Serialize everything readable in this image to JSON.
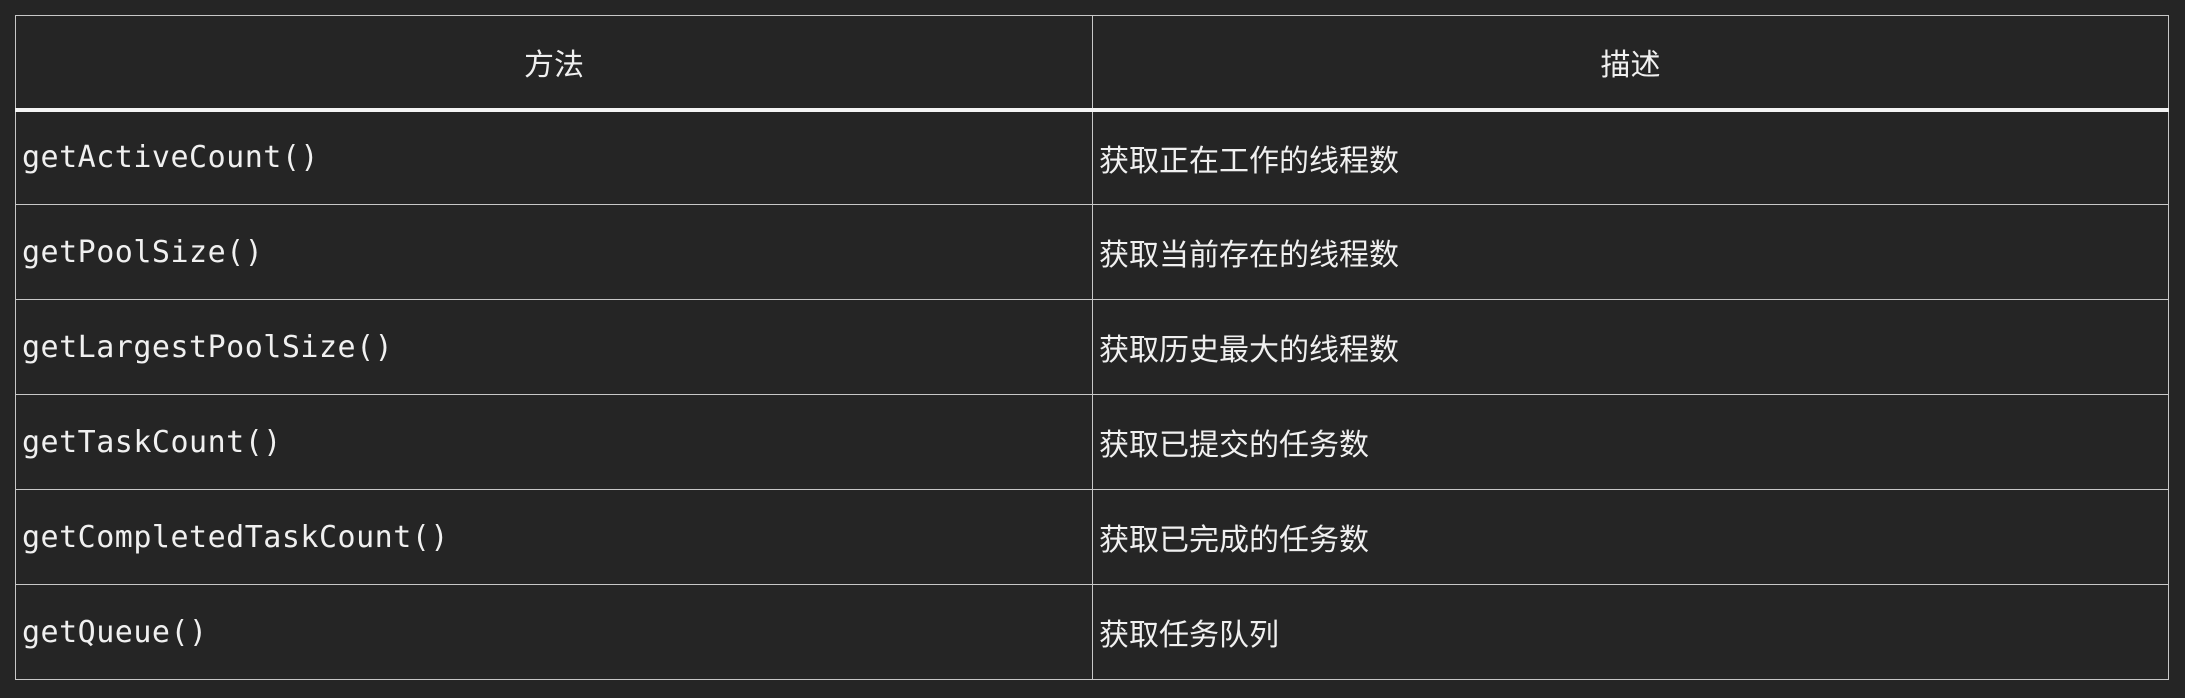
{
  "table": {
    "headers": [
      "方法",
      "描述"
    ],
    "rows": [
      {
        "method": "getActiveCount()",
        "description": "获取正在工作的线程数"
      },
      {
        "method": "getPoolSize()",
        "description": "获取当前存在的线程数"
      },
      {
        "method": "getLargestPoolSize()",
        "description": "获取历史最大的线程数"
      },
      {
        "method": "getTaskCount()",
        "description": "获取已提交的任务数"
      },
      {
        "method": "getCompletedTaskCount()",
        "description": "获取已完成的任务数"
      },
      {
        "method": "getQueue()",
        "description": "获取任务队列"
      }
    ]
  },
  "colors": {
    "background": "#252525",
    "text": "#f0f0f0",
    "border": "#c8c8c8"
  }
}
